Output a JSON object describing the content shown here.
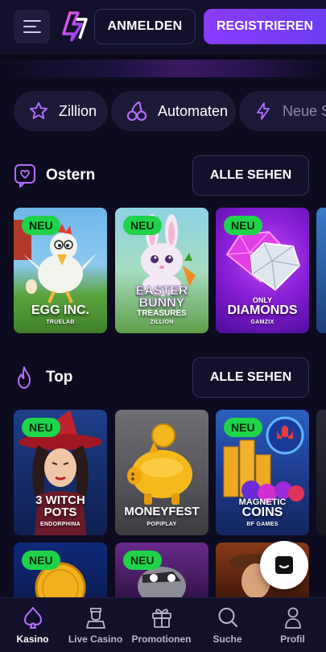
{
  "header": {
    "login_label": "ANMELDEN",
    "register_label": "REGISTRIEREN"
  },
  "categories": [
    {
      "label": "Zillion",
      "icon": "star-icon"
    },
    {
      "label": "Automaten",
      "icon": "cherries-icon"
    },
    {
      "label": "Neue Spiele",
      "icon": "lightning-icon"
    }
  ],
  "sections": [
    {
      "title": "Ostern",
      "icon": "easter-heart-icon",
      "see_all": "ALLE SEHEN",
      "games": [
        {
          "badge": "NEU",
          "title": "EGG INC.",
          "provider": "TRUELAB"
        },
        {
          "badge": "NEU",
          "title": "EASTER BUNNY",
          "subtitle": "TREASURES",
          "provider": "ZILLION"
        },
        {
          "badge": "NEU",
          "title_top": "ONLY",
          "title": "DIAMONDS",
          "provider": "GAMZIX"
        }
      ]
    },
    {
      "title": "Top",
      "icon": "flame-icon",
      "see_all": "ALLE SEHEN",
      "games": [
        {
          "badge": "NEU",
          "title": "3 WITCH POTS",
          "provider": "ENDORPHINA"
        },
        {
          "title": "MONEYFEST",
          "provider": "POPIPLAY"
        },
        {
          "badge": "NEU",
          "title_top": "MAGNETIC",
          "title": "COINS",
          "provider": "BF GAMES"
        }
      ]
    }
  ],
  "third_row_badges": [
    "NEU",
    "NEU"
  ],
  "bottom_nav": [
    {
      "label": "Kasino",
      "icon": "spade-icon",
      "active": true
    },
    {
      "label": "Live Casino",
      "icon": "dealer-icon",
      "active": false
    },
    {
      "label": "Promotionen",
      "icon": "gift-icon",
      "active": false
    },
    {
      "label": "Suche",
      "icon": "search-icon",
      "active": false
    },
    {
      "label": "Profil",
      "icon": "user-icon",
      "active": false
    }
  ],
  "colors": {
    "background": "#0d0b1f",
    "accent": "#8a3bff",
    "badge": "#1fd34a",
    "icon_purple": "#b56dff"
  }
}
